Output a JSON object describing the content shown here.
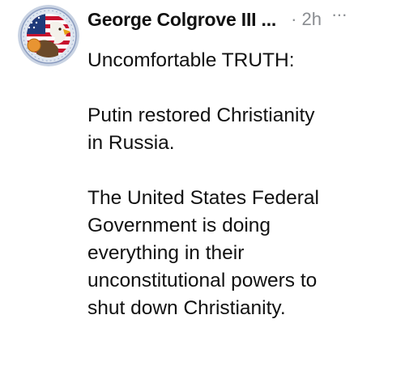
{
  "post": {
    "author": "George Colgrove III ...",
    "separator": "·",
    "timestamp": "2h",
    "more_label": "···",
    "avatar_icon": "eagle-flag-seal-icon",
    "paragraphs": [
      [
        "Uncomfortable TRUTH:"
      ],
      [
        "Putin restored Christianity",
        "in Russia."
      ],
      [
        "The United States Federal",
        "Government is doing",
        "everything in their",
        "unconstitutional powers to",
        "shut down Christianity."
      ]
    ]
  }
}
